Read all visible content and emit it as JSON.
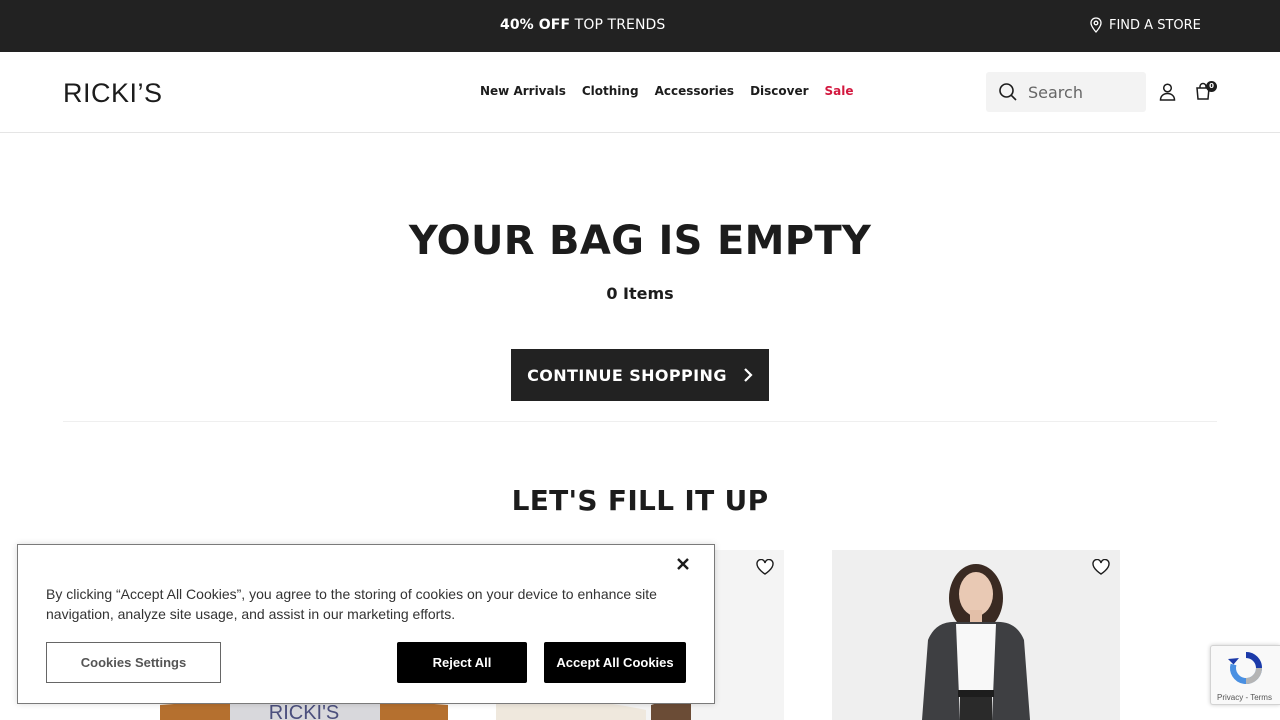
{
  "promo": {
    "bold": "40% OFF",
    "rest": " TOP TRENDS",
    "find_store": "FIND A STORE"
  },
  "header": {
    "logo": "RICKI’S",
    "nav": [
      "New Arrivals",
      "Clothing",
      "Accessories",
      "Discover",
      "Sale"
    ],
    "search_placeholder": "Search",
    "bag_count": "0"
  },
  "main": {
    "title": "YOUR BAG IS EMPTY",
    "items": "0 Items",
    "continue_label": "CONTINUE SHOPPING",
    "fill_title": "LET'S FILL IT UP"
  },
  "products": [
    {
      "brand_text": "RICKI'S"
    },
    {},
    {}
  ],
  "cookies": {
    "text": "By clicking “Accept All Cookies”, you agree to the storing of cookies on your device to enhance site navigation, analyze site usage, and assist in our marketing efforts.",
    "settings_label": "Cookies Settings",
    "reject_label": "Reject All",
    "accept_label": "Accept All Cookies"
  },
  "recaptcha": {
    "links": "Privacy - Terms"
  },
  "colors": {
    "dark": "#222222",
    "sale": "#d3183f"
  }
}
